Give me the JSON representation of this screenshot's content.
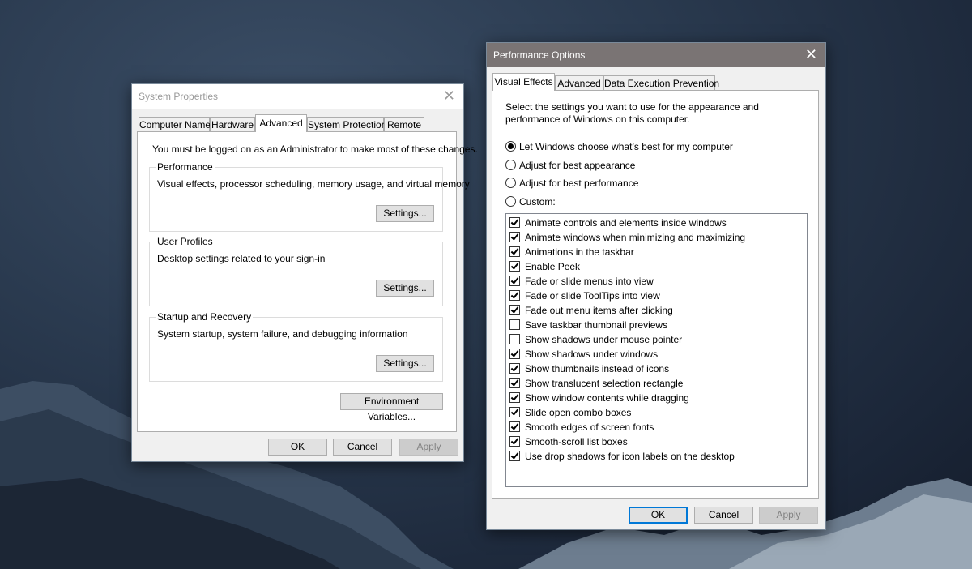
{
  "system_properties": {
    "title": "System Properties",
    "tabs": [
      "Computer Name",
      "Hardware",
      "Advanced",
      "System Protection",
      "Remote"
    ],
    "active_tab": "Advanced",
    "admin_note": "You must be logged on as an Administrator to make most of these changes.",
    "performance": {
      "title": "Performance",
      "description": "Visual effects, processor scheduling, memory usage, and virtual memory",
      "button": "Settings..."
    },
    "user_profiles": {
      "title": "User Profiles",
      "description": "Desktop settings related to your sign-in",
      "button": "Settings..."
    },
    "startup_recovery": {
      "title": "Startup and Recovery",
      "description": "System startup, system failure, and debugging information",
      "button": "Settings..."
    },
    "env_button": "Environment Variables...",
    "ok": "OK",
    "cancel": "Cancel",
    "apply": "Apply"
  },
  "performance_options": {
    "title": "Performance Options",
    "tabs": [
      "Visual Effects",
      "Advanced",
      "Data Execution Prevention"
    ],
    "active_tab": "Visual Effects",
    "intro_line1": "Select the settings you want to use for the appearance and",
    "intro_line2": "performance of Windows on this computer.",
    "radios": [
      {
        "label": "Let Windows choose what’s best for my computer",
        "checked": true
      },
      {
        "label": "Adjust for best appearance",
        "checked": false
      },
      {
        "label": "Adjust for best performance",
        "checked": false
      },
      {
        "label": "Custom:",
        "checked": false
      }
    ],
    "effects": [
      {
        "label": "Animate controls and elements inside windows",
        "checked": true
      },
      {
        "label": "Animate windows when minimizing and maximizing",
        "checked": true
      },
      {
        "label": "Animations in the taskbar",
        "checked": true
      },
      {
        "label": "Enable Peek",
        "checked": true
      },
      {
        "label": "Fade or slide menus into view",
        "checked": true
      },
      {
        "label": "Fade or slide ToolTips into view",
        "checked": true
      },
      {
        "label": "Fade out menu items after clicking",
        "checked": true
      },
      {
        "label": "Save taskbar thumbnail previews",
        "checked": false
      },
      {
        "label": "Show shadows under mouse pointer",
        "checked": false
      },
      {
        "label": "Show shadows under windows",
        "checked": true
      },
      {
        "label": "Show thumbnails instead of icons",
        "checked": true
      },
      {
        "label": "Show translucent selection rectangle",
        "checked": true
      },
      {
        "label": "Show window contents while dragging",
        "checked": true
      },
      {
        "label": "Slide open combo boxes",
        "checked": true
      },
      {
        "label": "Smooth edges of screen fonts",
        "checked": true
      },
      {
        "label": "Smooth-scroll list boxes",
        "checked": true
      },
      {
        "label": "Use drop shadows for icon labels on the desktop",
        "checked": true
      }
    ],
    "ok": "OK",
    "cancel": "Cancel",
    "apply": "Apply"
  },
  "colors": {
    "active_titlebar": "#7a7474",
    "inactive_titlebar": "#ffffff",
    "accent": "#0078d7"
  }
}
